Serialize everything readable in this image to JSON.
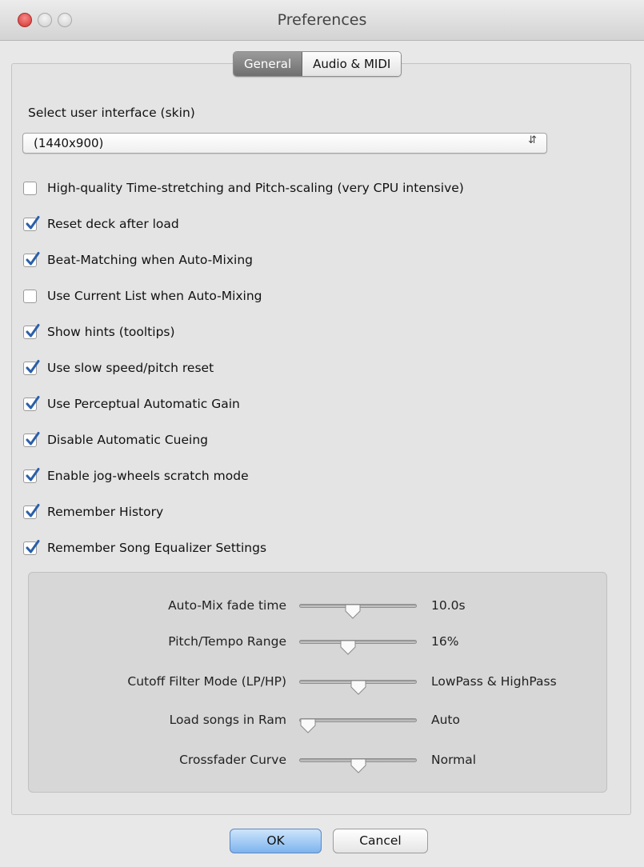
{
  "window": {
    "title": "Preferences"
  },
  "tabs": [
    {
      "label": "General",
      "active": true
    },
    {
      "label": "Audio & MIDI",
      "active": false
    }
  ],
  "skin": {
    "label": "Select user interface (skin)",
    "value": "(1440x900)"
  },
  "options": [
    {
      "label": "High-quality Time-stretching and Pitch-scaling (very CPU intensive)",
      "checked": false
    },
    {
      "label": "Reset deck after load",
      "checked": true
    },
    {
      "label": "Beat-Matching when Auto-Mixing",
      "checked": true
    },
    {
      "label": "Use Current List when Auto-Mixing",
      "checked": false
    },
    {
      "label": "Show hints (tooltips)",
      "checked": true
    },
    {
      "label": "Use slow speed/pitch reset",
      "checked": true
    },
    {
      "label": "Use Perceptual Automatic Gain",
      "checked": true
    },
    {
      "label": "Disable Automatic Cueing",
      "checked": true
    },
    {
      "label": "Enable jog-wheels scratch mode",
      "checked": true
    },
    {
      "label": "Remember History",
      "checked": true
    },
    {
      "label": "Remember Song Equalizer Settings",
      "checked": true
    }
  ],
  "sliders": [
    {
      "label": "Auto-Mix fade time",
      "value": "10.0s",
      "level": 0.45
    },
    {
      "label": "Pitch/Tempo Range",
      "value": "16%",
      "level": 0.4
    },
    {
      "label": "Cutoff Filter Mode (LP/HP)",
      "value": "LowPass & HighPass",
      "level": 0.5
    },
    {
      "label": "Load songs in Ram",
      "value": "Auto",
      "level": 0.0
    },
    {
      "label": "Crossfader Curve",
      "value": "Normal",
      "level": 0.5
    }
  ],
  "buttons": {
    "ok": "OK",
    "cancel": "Cancel"
  },
  "colors": {
    "check": "#2b5fa8",
    "ok_button": "#7db4ee",
    "close_button": "#d5302e"
  }
}
